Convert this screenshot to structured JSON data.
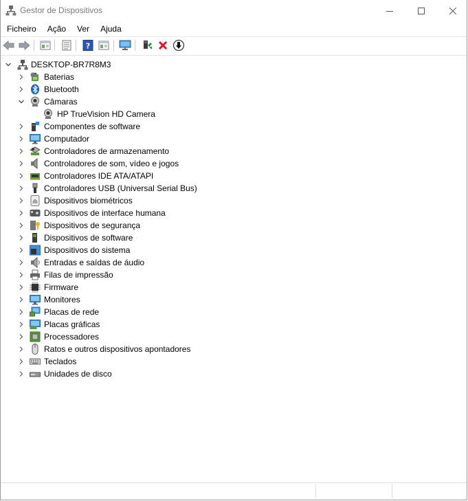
{
  "window": {
    "title": "Gestor de Dispositivos"
  },
  "menu": [
    "Ficheiro",
    "Ação",
    "Ver",
    "Ajuda"
  ],
  "toolbar": {
    "icons": [
      "back-arrow-icon",
      "forward-arrow-icon",
      "properties-icon",
      "update-list-icon",
      "help-icon",
      "view-icon",
      "monitor-icon",
      "update-driver-icon",
      "uninstall-icon",
      "disable-device-icon"
    ]
  },
  "tree": {
    "root": "DESKTOP-BR7R8M3",
    "categories": [
      {
        "label": "Baterias",
        "icon": "battery-icon",
        "expanded": false
      },
      {
        "label": "Bluetooth",
        "icon": "bluetooth-icon",
        "expanded": false
      },
      {
        "label": "Câmaras",
        "icon": "camera-icon",
        "expanded": true,
        "children": [
          "HP TrueVision HD Camera"
        ]
      },
      {
        "label": "Componentes de software",
        "icon": "software-component-icon",
        "expanded": false
      },
      {
        "label": "Computador",
        "icon": "computer-icon",
        "expanded": false
      },
      {
        "label": "Controladores de armazenamento",
        "icon": "storage-controller-icon",
        "expanded": false
      },
      {
        "label": "Controladores de som, vídeo e jogos",
        "icon": "sound-icon",
        "expanded": false
      },
      {
        "label": "Controladores IDE ATA/ATAPI",
        "icon": "ide-icon",
        "expanded": false
      },
      {
        "label": "Controladores USB (Universal Serial Bus)",
        "icon": "usb-icon",
        "expanded": false
      },
      {
        "label": "Dispositivos biométricos",
        "icon": "fingerprint-icon",
        "expanded": false
      },
      {
        "label": "Dispositivos de interface humana",
        "icon": "hid-icon",
        "expanded": false
      },
      {
        "label": "Dispositivos de segurança",
        "icon": "security-icon",
        "expanded": false
      },
      {
        "label": "Dispositivos de software",
        "icon": "software-device-icon",
        "expanded": false
      },
      {
        "label": "Dispositivos do sistema",
        "icon": "system-device-icon",
        "expanded": false
      },
      {
        "label": "Entradas e saídas de áudio",
        "icon": "audio-icon",
        "expanded": false
      },
      {
        "label": "Filas de impressão",
        "icon": "printer-icon",
        "expanded": false
      },
      {
        "label": "Firmware",
        "icon": "firmware-icon",
        "expanded": false
      },
      {
        "label": "Monitores",
        "icon": "monitor-icon",
        "expanded": false
      },
      {
        "label": "Placas de rede",
        "icon": "network-adapter-icon",
        "expanded": false
      },
      {
        "label": "Placas gráficas",
        "icon": "display-adapter-icon",
        "expanded": false
      },
      {
        "label": "Processadores",
        "icon": "processor-icon",
        "expanded": false
      },
      {
        "label": "Ratos e outros dispositivos apontadores",
        "icon": "mouse-icon",
        "expanded": false
      },
      {
        "label": "Teclados",
        "icon": "keyboard-icon",
        "expanded": false
      },
      {
        "label": "Unidades de disco",
        "icon": "disk-drive-icon",
        "expanded": false
      }
    ]
  },
  "colors": {
    "uninstall_red": "#e81123",
    "help_blue": "#2b56b5",
    "monitor_blue": "#3c8fd8",
    "green": "#2e8b3a"
  }
}
